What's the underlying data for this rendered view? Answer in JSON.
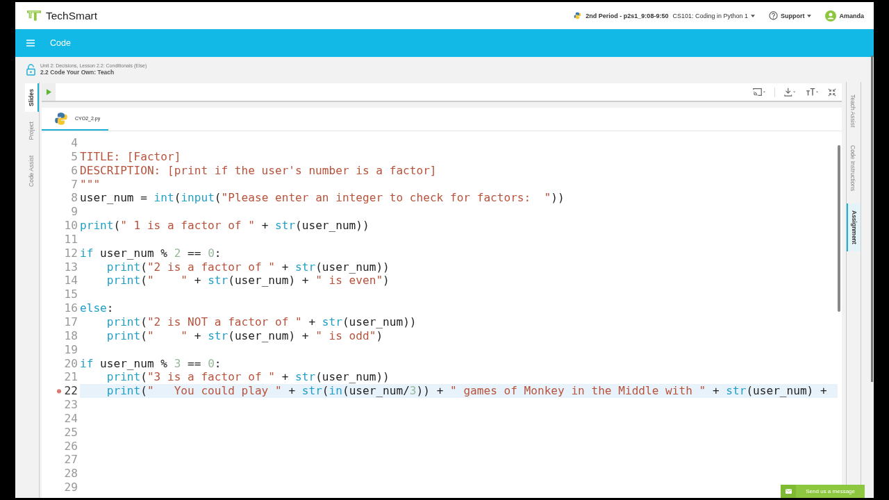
{
  "header": {
    "logo_text": "TechSmart",
    "class_period": "2nd Period - p2s1_9:08-9:50",
    "course": "CS101: Coding in Python 1",
    "support": "Support",
    "user": "Amanda"
  },
  "app_bar": {
    "title": "Code"
  },
  "breadcrumb": {
    "path": "Unit 2: Decisions, Lesson 2.2: Conditionals (Else)",
    "title": "2.2 Code Your Own: Teach"
  },
  "left_tabs": [
    {
      "label": "Slides",
      "selected": true
    },
    {
      "label": "Project",
      "selected": false
    },
    {
      "label": "Code Assist",
      "selected": false
    }
  ],
  "right_tabs": [
    {
      "label": "Teach Assist",
      "selected": false
    },
    {
      "label": "Code Instructions",
      "selected": false
    },
    {
      "label": "Assignment",
      "selected": true
    }
  ],
  "file_tabs": [
    {
      "label": "CYO2_2.py",
      "selected": true
    }
  ],
  "code": {
    "lines": [
      {
        "number": "4",
        "active": false,
        "error": false
      },
      {
        "number": "5",
        "active": false,
        "error": false,
        "tokens": [
          {
            "kind": "str",
            "t": "TITLE: [Factor]"
          }
        ]
      },
      {
        "number": "6",
        "active": false,
        "error": false,
        "tokens": [
          {
            "kind": "str",
            "t": "DESCRIPTION: [print if the user's number is a factor]"
          }
        ]
      },
      {
        "number": "7",
        "active": false,
        "error": false,
        "tokens": [
          {
            "kind": "str",
            "t": "\"\"\""
          }
        ]
      },
      {
        "number": "8",
        "active": false,
        "error": false,
        "tokens": [
          {
            "kind": "plain",
            "t": "user_num = "
          },
          {
            "kind": "kw",
            "t": "int"
          },
          {
            "kind": "plain",
            "t": "("
          },
          {
            "kind": "kw",
            "t": "input"
          },
          {
            "kind": "plain",
            "t": "("
          },
          {
            "kind": "str",
            "t": "\"Please enter an integer to check for factors:  \""
          },
          {
            "kind": "plain",
            "t": "))"
          }
        ]
      },
      {
        "number": "9",
        "active": false,
        "error": false
      },
      {
        "number": "10",
        "active": false,
        "error": false,
        "tokens": [
          {
            "kind": "kw",
            "t": "print"
          },
          {
            "kind": "plain",
            "t": "("
          },
          {
            "kind": "str",
            "t": "\" 1 is a factor of \""
          },
          {
            "kind": "plain",
            "t": " + "
          },
          {
            "kind": "kw",
            "t": "str"
          },
          {
            "kind": "plain",
            "t": "(user_num))"
          }
        ]
      },
      {
        "number": "11",
        "active": false,
        "error": false
      },
      {
        "number": "12",
        "active": false,
        "error": false,
        "tokens": [
          {
            "kind": "kw",
            "t": "if"
          },
          {
            "kind": "plain",
            "t": " user_num % "
          },
          {
            "kind": "num",
            "t": "2"
          },
          {
            "kind": "plain",
            "t": " == "
          },
          {
            "kind": "num",
            "t": "0"
          },
          {
            "kind": "plain",
            "t": ":"
          }
        ]
      },
      {
        "number": "13",
        "active": false,
        "error": false,
        "indented": true,
        "tokens": [
          {
            "kind": "kw",
            "t": "print"
          },
          {
            "kind": "plain",
            "t": "("
          },
          {
            "kind": "str",
            "t": "\"2 is a factor of \""
          },
          {
            "kind": "plain",
            "t": " + "
          },
          {
            "kind": "kw",
            "t": "str"
          },
          {
            "kind": "plain",
            "t": "(user_num))"
          }
        ]
      },
      {
        "number": "14",
        "active": false,
        "error": false,
        "indented": true,
        "tokens": [
          {
            "kind": "kw",
            "t": "print"
          },
          {
            "kind": "plain",
            "t": "("
          },
          {
            "kind": "str",
            "t": "\"    \""
          },
          {
            "kind": "plain",
            "t": " + "
          },
          {
            "kind": "kw",
            "t": "str"
          },
          {
            "kind": "plain",
            "t": "(user_num) + "
          },
          {
            "kind": "str",
            "t": "\" is even\""
          },
          {
            "kind": "plain",
            "t": ")"
          }
        ]
      },
      {
        "number": "15",
        "active": false,
        "error": false
      },
      {
        "number": "16",
        "active": false,
        "error": false,
        "tokens": [
          {
            "kind": "kw",
            "t": "else"
          },
          {
            "kind": "plain",
            "t": ":"
          }
        ]
      },
      {
        "number": "17",
        "active": false,
        "error": false,
        "indented": true,
        "tokens": [
          {
            "kind": "kw",
            "t": "print"
          },
          {
            "kind": "plain",
            "t": "("
          },
          {
            "kind": "str",
            "t": "\"2 is NOT a factor of \""
          },
          {
            "kind": "plain",
            "t": " + "
          },
          {
            "kind": "kw",
            "t": "str"
          },
          {
            "kind": "plain",
            "t": "(user_num))"
          }
        ]
      },
      {
        "number": "18",
        "active": false,
        "error": false,
        "indented": true,
        "tokens": [
          {
            "kind": "kw",
            "t": "print"
          },
          {
            "kind": "plain",
            "t": "("
          },
          {
            "kind": "str",
            "t": "\"    \""
          },
          {
            "kind": "plain",
            "t": " + "
          },
          {
            "kind": "kw",
            "t": "str"
          },
          {
            "kind": "plain",
            "t": "(user_num) + "
          },
          {
            "kind": "str",
            "t": "\" is odd\""
          },
          {
            "kind": "plain",
            "t": ")"
          }
        ]
      },
      {
        "number": "19",
        "active": false,
        "error": false
      },
      {
        "number": "20",
        "active": false,
        "error": false,
        "tokens": [
          {
            "kind": "kw",
            "t": "if"
          },
          {
            "kind": "plain",
            "t": " user_num % "
          },
          {
            "kind": "num",
            "t": "3"
          },
          {
            "kind": "plain",
            "t": " == "
          },
          {
            "kind": "num",
            "t": "0"
          },
          {
            "kind": "plain",
            "t": ":"
          }
        ]
      },
      {
        "number": "21",
        "active": false,
        "error": false,
        "indented": true,
        "tokens": [
          {
            "kind": "kw",
            "t": "print"
          },
          {
            "kind": "plain",
            "t": "("
          },
          {
            "kind": "str",
            "t": "\"3 is a factor of \""
          },
          {
            "kind": "plain",
            "t": " + "
          },
          {
            "kind": "kw",
            "t": "str"
          },
          {
            "kind": "plain",
            "t": "(user_num))"
          }
        ]
      },
      {
        "number": "22",
        "active": true,
        "error": true,
        "indented": true,
        "tokens": [
          {
            "kind": "kw",
            "t": "print"
          },
          {
            "kind": "plain",
            "t": "("
          },
          {
            "kind": "str",
            "t": "\"   You could play \""
          },
          {
            "kind": "plain",
            "t": " + "
          },
          {
            "kind": "kw",
            "t": "str"
          },
          {
            "kind": "plain",
            "t": "("
          },
          {
            "kind": "kw",
            "t": "in"
          },
          {
            "kind": "plain",
            "t": "(user_num/"
          },
          {
            "kind": "num",
            "t": "3"
          },
          {
            "kind": "plain",
            "t": ")) + "
          },
          {
            "kind": "str",
            "t": "\" games of Monkey in the Middle with \""
          },
          {
            "kind": "plain",
            "t": " + "
          },
          {
            "kind": "kw",
            "t": "str"
          },
          {
            "kind": "plain",
            "t": "(user_num) +"
          }
        ]
      },
      {
        "number": "23",
        "active": false,
        "error": false
      },
      {
        "number": "24",
        "active": false,
        "error": false
      },
      {
        "number": "25",
        "active": false,
        "error": false
      },
      {
        "number": "26",
        "active": false,
        "error": false
      },
      {
        "number": "27",
        "active": false,
        "error": false
      },
      {
        "number": "28",
        "active": false,
        "error": false
      },
      {
        "number": "29",
        "active": false,
        "error": false
      }
    ]
  },
  "chat_button": {
    "label": "Send us a message"
  }
}
